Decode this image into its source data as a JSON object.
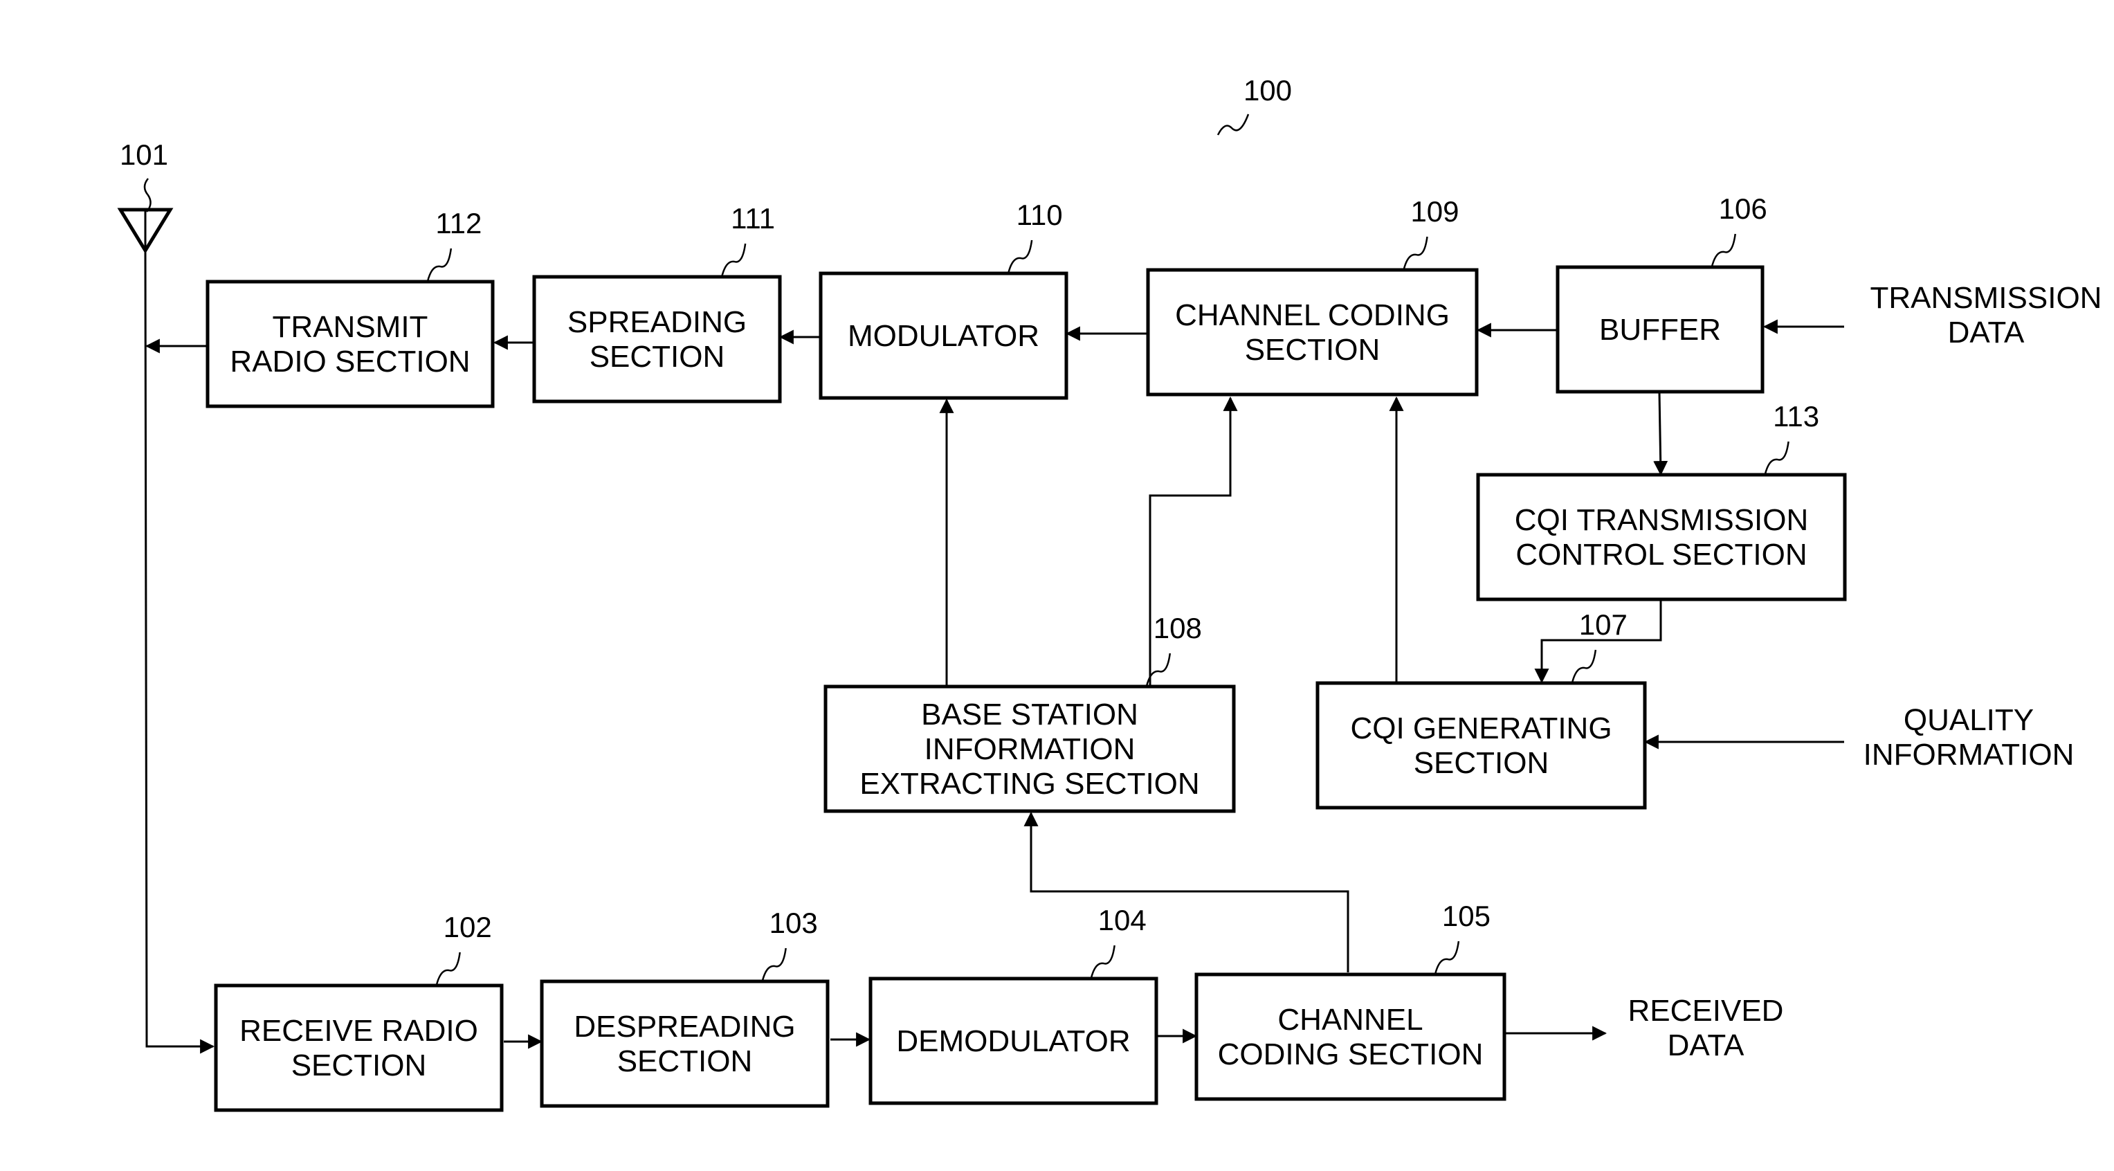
{
  "figure": {
    "ref": "100"
  },
  "antenna": {
    "ref": "101",
    "icon": "antenna-icon"
  },
  "blocks": [
    {
      "id": "transmit-radio",
      "ref": "112",
      "lines": [
        "TRANSMIT",
        "RADIO SECTION"
      ]
    },
    {
      "id": "spreading",
      "ref": "111",
      "lines": [
        "SPREADING",
        "SECTION"
      ]
    },
    {
      "id": "modulator",
      "ref": "110",
      "lines": [
        "MODULATOR"
      ]
    },
    {
      "id": "channel-coding-tx",
      "ref": "109",
      "lines": [
        "CHANNEL CODING",
        "SECTION"
      ]
    },
    {
      "id": "buffer",
      "ref": "106",
      "lines": [
        "BUFFER"
      ]
    },
    {
      "id": "cqi-transmission-control",
      "ref": "113",
      "lines": [
        "CQI TRANSMISSION",
        "CONTROL SECTION"
      ]
    },
    {
      "id": "base-station-info-extracting",
      "ref": "108",
      "lines": [
        "BASE STATION",
        "INFORMATION",
        "EXTRACTING SECTION"
      ]
    },
    {
      "id": "cqi-generating",
      "ref": "107",
      "lines": [
        "CQI GENERATING",
        "SECTION"
      ]
    },
    {
      "id": "receive-radio",
      "ref": "102",
      "lines": [
        "RECEIVE RADIO",
        "SECTION"
      ]
    },
    {
      "id": "despreading",
      "ref": "103",
      "lines": [
        "DESPREADING",
        "SECTION"
      ]
    },
    {
      "id": "demodulator",
      "ref": "104",
      "lines": [
        "DEMODULATOR"
      ]
    },
    {
      "id": "channel-coding-rx",
      "ref": "105",
      "lines": [
        "CHANNEL",
        "CODING SECTION"
      ]
    }
  ],
  "io_labels": [
    {
      "id": "transmission-data",
      "lines": [
        "TRANSMISSION",
        "DATA"
      ]
    },
    {
      "id": "quality-information",
      "lines": [
        "QUALITY",
        "INFORMATION"
      ]
    },
    {
      "id": "received-data",
      "lines": [
        "RECEIVED",
        "DATA"
      ]
    }
  ],
  "connections": [
    {
      "from": "transmission-data",
      "to": "buffer"
    },
    {
      "from": "buffer",
      "to": "channel-coding-tx"
    },
    {
      "from": "buffer",
      "to": "cqi-transmission-control"
    },
    {
      "from": "cqi-transmission-control",
      "to": "cqi-generating"
    },
    {
      "from": "quality-information",
      "to": "cqi-generating"
    },
    {
      "from": "cqi-generating",
      "to": "channel-coding-tx"
    },
    {
      "from": "base-station-info-extracting",
      "to": "channel-coding-tx"
    },
    {
      "from": "base-station-info-extracting",
      "to": "modulator"
    },
    {
      "from": "channel-coding-tx",
      "to": "modulator"
    },
    {
      "from": "modulator",
      "to": "spreading"
    },
    {
      "from": "spreading",
      "to": "transmit-radio"
    },
    {
      "from": "transmit-radio",
      "to": "antenna"
    },
    {
      "from": "antenna",
      "to": "receive-radio"
    },
    {
      "from": "receive-radio",
      "to": "despreading"
    },
    {
      "from": "despreading",
      "to": "demodulator"
    },
    {
      "from": "demodulator",
      "to": "channel-coding-rx"
    },
    {
      "from": "channel-coding-rx",
      "to": "received-data"
    },
    {
      "from": "channel-coding-rx",
      "to": "base-station-info-extracting"
    }
  ]
}
